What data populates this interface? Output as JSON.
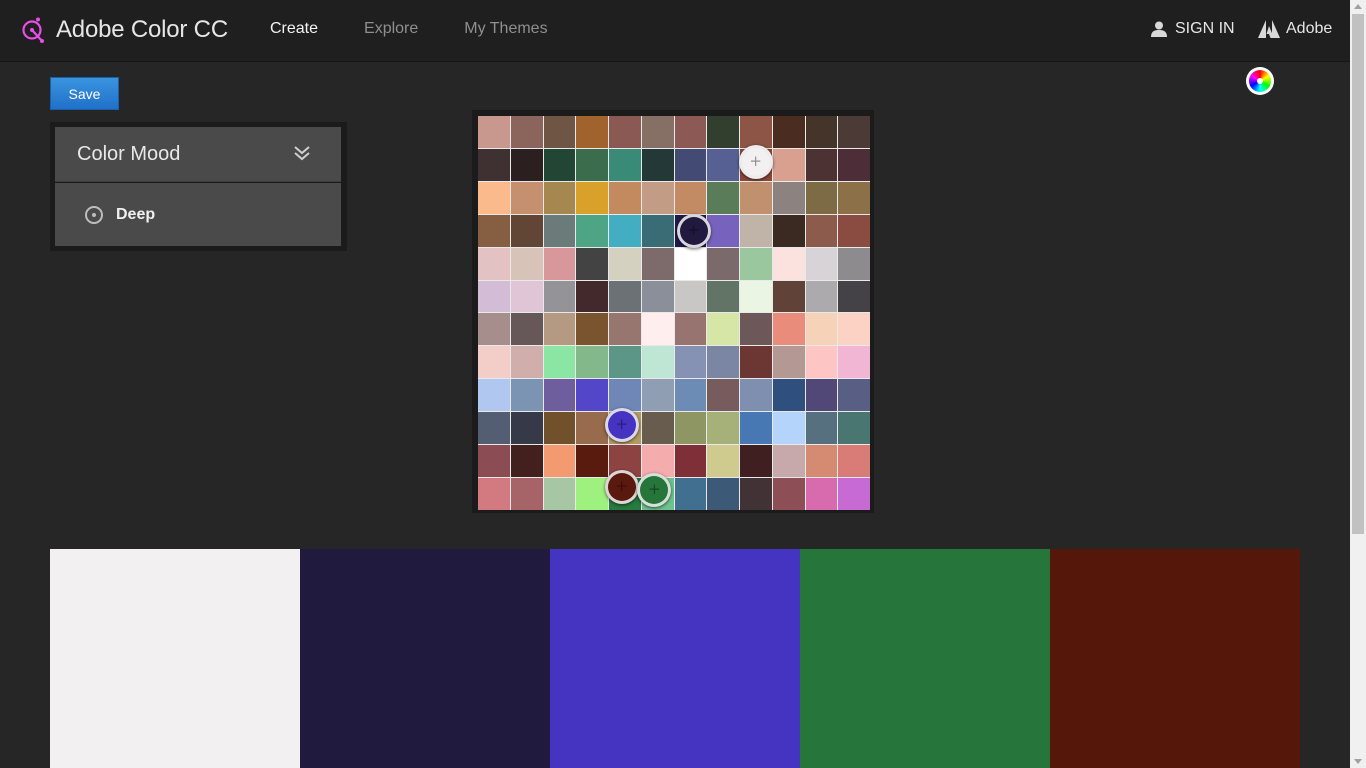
{
  "header": {
    "app_title": "Adobe Color CC",
    "nav": [
      {
        "label": "Create",
        "active": true
      },
      {
        "label": "Explore",
        "active": false
      },
      {
        "label": "My Themes",
        "active": false
      }
    ],
    "signin_label": "SIGN IN",
    "adobe_label": "Adobe",
    "logo_icon": "adobe-color-logo-icon",
    "accent_color": "#e94ee9"
  },
  "toolbar": {
    "save_label": "Save",
    "color_wheel_icon": "color-wheel-icon"
  },
  "color_mood_panel": {
    "title": "Color Mood",
    "expand_icon": "double-chevron-down-icon",
    "selected_mood": "Deep",
    "radio_icon": "radio-selected-icon"
  },
  "color_grid": {
    "rows": 12,
    "cols": 12,
    "cells": [
      [
        "#c8978d",
        "#8b645c",
        "#6f5544",
        "#a0632e",
        "#8b5954",
        "#867066",
        "#8c5954",
        "#323f2f",
        "#8c5545",
        "#4a2c21",
        "#443429",
        "#4b3a36"
      ],
      [
        "#3f3032",
        "#2c1f1f",
        "#214633",
        "#3b6c4b",
        "#3a8a78",
        "#253838",
        "#434a73",
        "#566093",
        "#8b4739",
        "#d9a090",
        "#4c3233",
        "#4c2d38"
      ],
      [
        "#fbba8b",
        "#c4906d",
        "#a5884f",
        "#d9a12a",
        "#c38a5f",
        "#c29c85",
        "#c38b64",
        "#5b7c59",
        "#c0906f",
        "#8c8381",
        "#7c6b44",
        "#8c7048"
      ],
      [
        "#865e42",
        "#614535",
        "#6a7b79",
        "#4ea585",
        "#43aec1",
        "#396c74",
        "#1f1a4c",
        "#7763bd",
        "#c0b3a7",
        "#3a2a22",
        "#8c5b4b",
        "#8a4c41"
      ],
      [
        "#e3c2c3",
        "#d7c3b7",
        "#d8979a",
        "#434343",
        "#d5d1c0",
        "#7d6b6c",
        "#ffffff",
        "#7a6a6b",
        "#9bc79e",
        "#fbe2df",
        "#d7d3d6",
        "#8d8b8d"
      ],
      [
        "#d3bcd6",
        "#e0c5d6",
        "#949397",
        "#43292c",
        "#6b7175",
        "#8b8f99",
        "#c8c7c6",
        "#627466",
        "#eaf5e3",
        "#604238",
        "#adaaad",
        "#444246"
      ],
      [
        "#a58e8b",
        "#665758",
        "#b39a80",
        "#7a532f",
        "#977670",
        "#ffeeed",
        "#977470",
        "#d6e6a6",
        "#6c5759",
        "#ea8c7c",
        "#f6d2b9",
        "#fcd2c4"
      ],
      [
        "#f3cec9",
        "#cfaeab",
        "#8ae6a2",
        "#83b98a",
        "#5c9687",
        "#bfe5d5",
        "#8592b4",
        "#7b87a2",
        "#6c3633",
        "#b39893",
        "#fdc6c5",
        "#f0b6d4"
      ],
      [
        "#b0c7ef",
        "#7c94b3",
        "#6f5e9d",
        "#5446c8",
        "#6e87b6",
        "#8f9eb3",
        "#6d8cb5",
        "#775c5e",
        "#7e8fb0",
        "#2f4f7f",
        "#514877",
        "#585e84"
      ],
      [
        "#545e73",
        "#363a48",
        "#70512c",
        "#986b4d",
        "#b39a62",
        "#675c4d",
        "#8e9764",
        "#a6b17a",
        "#4878b4",
        "#b4d4fb",
        "#57707f",
        "#4a7672"
      ],
      [
        "#8c4c53",
        "#41201e",
        "#f49a70",
        "#5a1b0f",
        "#8e4343",
        "#f4acac",
        "#7e2f37",
        "#cfca8e",
        "#3f1f1f",
        "#c7a8ab",
        "#d58b71",
        "#d97c77"
      ],
      [
        "#d17a7f",
        "#a76468",
        "#a6c6a4",
        "#9ff17f",
        "#277a40",
        "#6cc38e",
        "#406f8f",
        "#3c5a77",
        "#403235",
        "#8d4e56",
        "#d86aae",
        "#c86ad4"
      ]
    ]
  },
  "markers": [
    {
      "color": "#f2f0f1",
      "row": 0.9,
      "col": 8.0,
      "label": "marker-1"
    },
    {
      "color": "#21193f",
      "row": 3.0,
      "col": 6.1,
      "label": "marker-2"
    },
    {
      "color": "#4533c2",
      "row": 8.9,
      "col": 3.9,
      "label": "marker-3"
    },
    {
      "color": "#5a190f",
      "row": 10.8,
      "col": 3.9,
      "label": "marker-4"
    },
    {
      "color": "#26753b",
      "row": 10.9,
      "col": 4.9,
      "label": "marker-5"
    }
  ],
  "palette": [
    {
      "hex": "#f2f0f1"
    },
    {
      "hex": "#211a3f"
    },
    {
      "hex": "#4533c2"
    },
    {
      "hex": "#26753b"
    },
    {
      "hex": "#551709"
    }
  ]
}
